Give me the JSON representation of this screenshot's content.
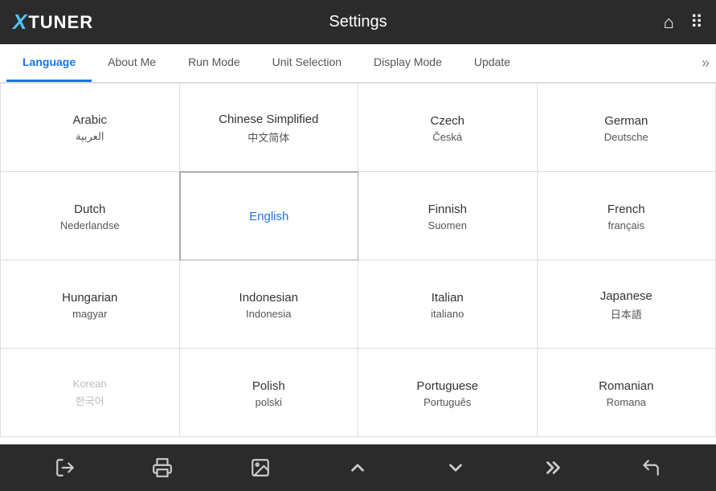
{
  "header": {
    "logo_x": "X",
    "logo_tuner": "TUNER",
    "title": "Settings"
  },
  "nav": {
    "tabs": [
      {
        "label": "Language",
        "active": true
      },
      {
        "label": "About Me",
        "active": false
      },
      {
        "label": "Run Mode",
        "active": false
      },
      {
        "label": "Unit Selection",
        "active": false
      },
      {
        "label": "Display Mode",
        "active": false
      },
      {
        "label": "Update",
        "active": false
      }
    ],
    "more_icon": "»"
  },
  "languages": [
    {
      "primary": "Arabic",
      "secondary": "العربية",
      "selected": false,
      "grayed": false
    },
    {
      "primary": "Chinese Simplified",
      "secondary": "中文简体",
      "selected": false,
      "grayed": false
    },
    {
      "primary": "Czech",
      "secondary": "Česká",
      "selected": false,
      "grayed": false
    },
    {
      "primary": "German",
      "secondary": "Deutsche",
      "selected": false,
      "grayed": false
    },
    {
      "primary": "Dutch",
      "secondary": "Nederlandse",
      "selected": false,
      "grayed": false
    },
    {
      "primary": "English",
      "secondary": "",
      "selected": true,
      "grayed": false
    },
    {
      "primary": "Finnish",
      "secondary": "Suomen",
      "selected": false,
      "grayed": false
    },
    {
      "primary": "French",
      "secondary": "français",
      "selected": false,
      "grayed": false
    },
    {
      "primary": "Hungarian",
      "secondary": "magyar",
      "selected": false,
      "grayed": false
    },
    {
      "primary": "Indonesian",
      "secondary": "Indonesia",
      "selected": false,
      "grayed": false
    },
    {
      "primary": "Italian",
      "secondary": "italiano",
      "selected": false,
      "grayed": false
    },
    {
      "primary": "Japanese",
      "secondary": "日本語",
      "selected": false,
      "grayed": false
    },
    {
      "primary": "Korean",
      "secondary": "한국어",
      "selected": false,
      "grayed": true
    },
    {
      "primary": "Polish",
      "secondary": "polski",
      "selected": false,
      "grayed": false
    },
    {
      "primary": "Portuguese",
      "secondary": "Português",
      "selected": false,
      "grayed": false
    },
    {
      "primary": "Romanian",
      "secondary": "Romana",
      "selected": false,
      "grayed": false
    }
  ],
  "footer": {
    "buttons": [
      {
        "name": "logout",
        "icon": "⏏",
        "unicode": "exit"
      },
      {
        "name": "print",
        "icon": "🖨",
        "unicode": "print"
      },
      {
        "name": "image",
        "icon": "🖼",
        "unicode": "image"
      },
      {
        "name": "chevron-up",
        "icon": "⌃",
        "unicode": "up"
      },
      {
        "name": "chevron-down",
        "icon": "⌄",
        "unicode": "down"
      },
      {
        "name": "fast-forward",
        "icon": "»",
        "unicode": "ff"
      },
      {
        "name": "back",
        "icon": "↩",
        "unicode": "back"
      }
    ]
  },
  "colors": {
    "header_bg": "#2b2b2b",
    "active_tab": "#1a73e8",
    "selected_lang": "#1a73e8",
    "grid_border": "#ddd"
  }
}
